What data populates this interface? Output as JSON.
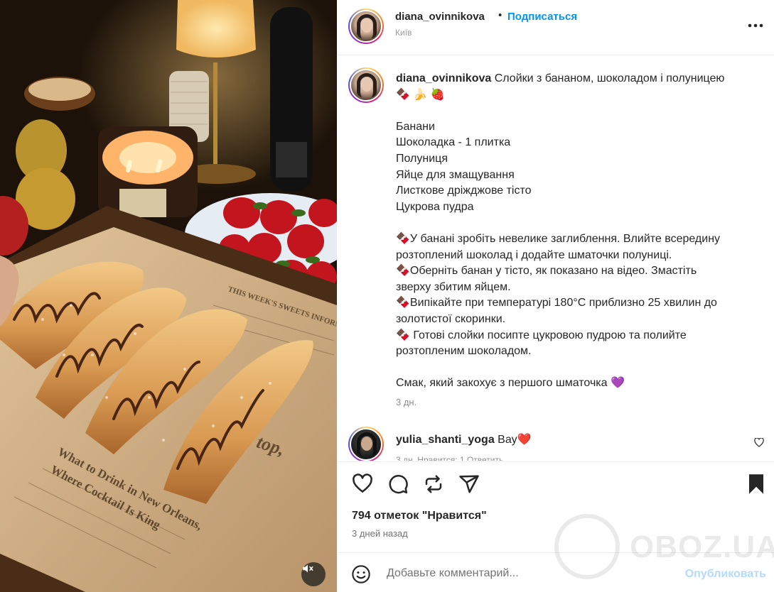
{
  "post": {
    "author": "diana_ovinnikova",
    "dot": "•",
    "follow_label": "Подписаться",
    "location": "Київ"
  },
  "caption": {
    "author": "diana_ovinnikova",
    "title": "Слойки з бананом, шоколадом і полуницею",
    "emojis": "🍫 🍌 🍓",
    "ingredients": [
      "Банани",
      "Шоколадка - 1 плитка",
      "Полуниця",
      "Яйце для змащування",
      "Листкове дріжджове тісто",
      "Цукрова пудра"
    ],
    "steps": [
      "🍫У банані зробіть невелике заглиблення. Влийте всередину",
      "розтоплений шоколад і додайте шматочки полуниці.",
      "🍫Оберніть банан у тісто, як показано на відео. Змастіть",
      "зверху збитим яйцем.",
      "🍫Випікайте при температурі 180°C приблизно 25 хвилин до",
      "золотистої скоринки.",
      "🍫 Готові слойки посипте цукровою пудрою та полийте",
      "розтопленим шоколадом."
    ],
    "closing": "Смак, який закохує з першого шматочка 💜",
    "age": "3 дн."
  },
  "comment": {
    "author": "yulia_shanti_yoga",
    "text": "Вау❤️",
    "meta": "3 дн.    Нравится: 1    Ответить"
  },
  "stats": {
    "likes": "794 отметок \"Нравится\"",
    "posted": "3 дней назад"
  },
  "add_comment": {
    "placeholder": "Добавьте комментарий...",
    "post_label": "Опубликовать"
  },
  "watermark": {
    "text": "OBOZ.UA"
  },
  "colors": {
    "accent": "#0095f6",
    "post_disabled": "#b3dbff",
    "muted": "#8e8e8e"
  },
  "icons": [
    "more-options-icon",
    "heart-icon",
    "comment-icon",
    "repost-icon",
    "share-icon",
    "bookmark-icon",
    "smiley-icon",
    "mute-icon"
  ]
}
